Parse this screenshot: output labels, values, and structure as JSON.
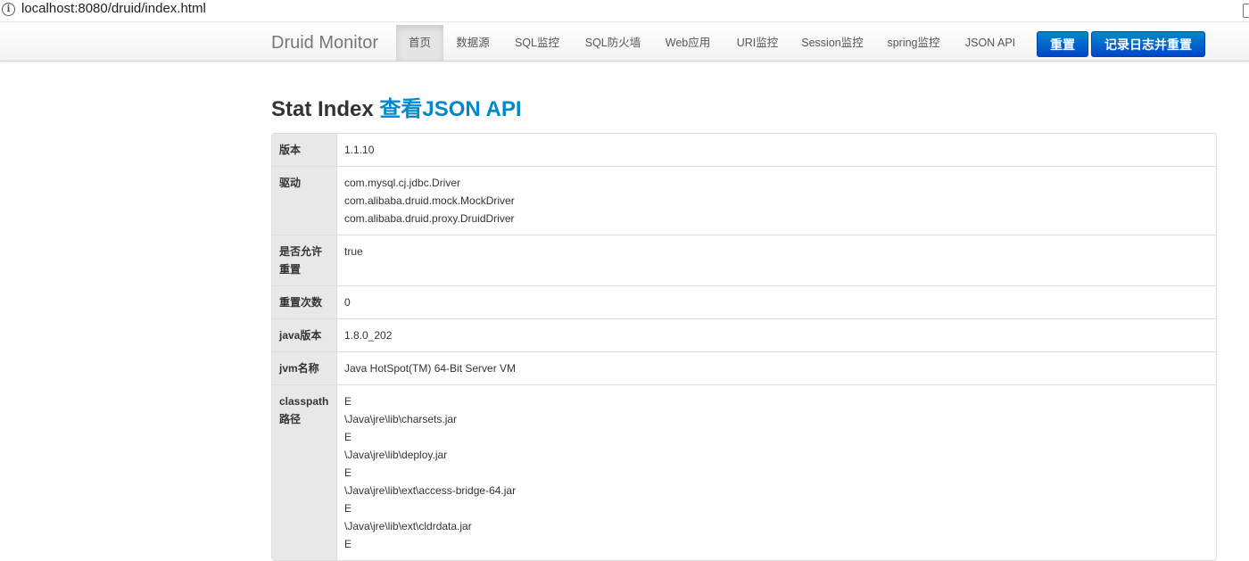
{
  "browser": {
    "url": "localhost:8080/druid/index.html"
  },
  "navbar": {
    "brand": "Druid Monitor",
    "items": [
      {
        "label": "首页",
        "active": true
      },
      {
        "label": "数据源"
      },
      {
        "label": "SQL监控"
      },
      {
        "label": "SQL防火墙"
      },
      {
        "label": "Web应用"
      },
      {
        "label": "URI监控"
      },
      {
        "label": "Session监控"
      },
      {
        "label": "spring监控"
      },
      {
        "label": "JSON API"
      }
    ],
    "reset_label": "重置",
    "log_reset_label": "记录日志并重置"
  },
  "page": {
    "title": "Stat Index",
    "json_link": "查看JSON API"
  },
  "stats": {
    "version": {
      "label": "版本",
      "value": "1.1.10"
    },
    "drivers": {
      "label": "驱动",
      "values": [
        "com.mysql.cj.jdbc.Driver",
        "com.alibaba.druid.mock.MockDriver",
        "com.alibaba.druid.proxy.DruidDriver"
      ]
    },
    "reset_enabled": {
      "label_line1": "是否允许",
      "label_line2": "重置",
      "value": "true"
    },
    "reset_count": {
      "label": "重置次数",
      "value": "0"
    },
    "java_version": {
      "label": "java版本",
      "value": "1.8.0_202"
    },
    "jvm_name": {
      "label": "jvm名称",
      "value": "Java HotSpot(TM) 64-Bit Server VM"
    },
    "classpath": {
      "label_line1": "classpath",
      "label_line2": "路径",
      "values": [
        "E",
        "\\Java\\jre\\lib\\charsets.jar",
        "E",
        "\\Java\\jre\\lib\\deploy.jar",
        "E",
        "\\Java\\jre\\lib\\ext\\access-bridge-64.jar",
        "E",
        "\\Java\\jre\\lib\\ext\\cldrdata.jar",
        "E"
      ]
    }
  },
  "colors": {
    "link": "#0088cc",
    "primary_button": "#0055cc",
    "key_cell_bg": "#e8e8e8"
  }
}
